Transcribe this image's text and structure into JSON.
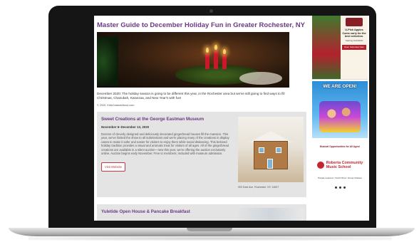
{
  "article": {
    "title": "Master Guide to December Holiday Fun in Greater Rochester, NY",
    "intro": "December 2020: The holiday season is going to be different this year, in the Rochester area but we've still going to find ways to fill Christmas, Chanukah, Kwanzaa, and New Year's with fun!",
    "credit": "© 2020, KidsOutandAbout.com"
  },
  "events": [
    {
      "title": "Sweet Creations at the George Eastman Museum",
      "date": "November 6–December 13, 2020",
      "body": "Dozens of cleverly designed and deliciously decorated gingerbread houses fill the mansion. This year, we've limited the show to all submissions and we're placing many of the creations in display cases to make it safer and easier for visitors to enjoy them while social distancing. This beloved holiday tradition provides a visual and aromatic treat for visitors of all ages. All of the gingerbread creations are available in a silent auction—new this year, we're offering the auction exclusively online. Auction begins early November. Free to members; included with museum admission.",
      "button": "Visit Website",
      "caption": "900 East Ave, Rochester, NY 14607"
    },
    {
      "title": "Yuletide Open House & Pancake Breakfast"
    }
  ],
  "sidebar": {
    "ad1": {
      "headline": "U-Pick Apples Come early for the best selection.",
      "detail": "Starting 9/12/2020",
      "banner": "Open Saturdays 9am"
    },
    "ad2": {
      "headline": "WE ARE OPEN!"
    },
    "ad3": {
      "top": "Musical Opportunities for All Ages!",
      "school_line1": "Roberta Community",
      "school_line2": "Music School",
      "lessons": "Private Lessons / Youth Choir / Group Classes"
    }
  }
}
